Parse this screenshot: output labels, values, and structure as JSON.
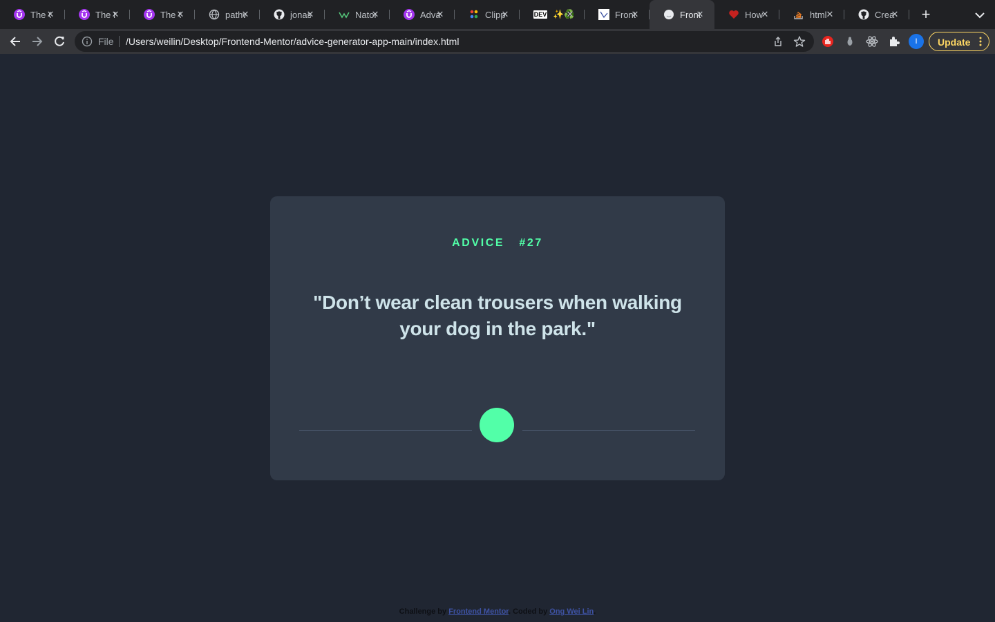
{
  "browser": {
    "tabs": [
      {
        "title": "The C",
        "icon": "udemy-icon"
      },
      {
        "title": "The N",
        "icon": "udemy-icon"
      },
      {
        "title": "The C",
        "icon": "udemy-icon"
      },
      {
        "title": "pathw",
        "icon": "globe-icon"
      },
      {
        "title": "jonas",
        "icon": "github-icon"
      },
      {
        "title": "Nator",
        "icon": "natours-icon"
      },
      {
        "title": "Adva",
        "icon": "udemy-icon"
      },
      {
        "title": "Clipp",
        "icon": "dots-icon"
      },
      {
        "title": "✨♻️",
        "icon": "dev-icon",
        "badge": "DEV"
      },
      {
        "title": "Front",
        "icon": "frontendmentor-icon"
      },
      {
        "title": "Front",
        "icon": "blank-page-icon",
        "active": true
      },
      {
        "title": "How",
        "icon": "heart-icon"
      },
      {
        "title": "html",
        "icon": "stackoverflow-icon"
      },
      {
        "title": "Crea",
        "icon": "github-icon"
      }
    ],
    "address": {
      "scheme": "File",
      "url": "/Users/weilin/Desktop/Frontend-Mentor/advice-generator-app-main/index.html"
    },
    "profile_initial": "I",
    "update_label": "Update"
  },
  "card": {
    "label": "ADVICE",
    "number": "#27",
    "quote": "\"Don’t wear clean trousers when walking your dog in the park.\""
  },
  "footer": {
    "prefix": "Challenge by",
    "link1": "Frontend Mentor",
    "middle": ". Coded by",
    "link2": "Ong Wei Lin",
    "suffix": "."
  },
  "colors": {
    "page_bg": "#202632",
    "card_bg": "#313a48",
    "accent": "#52ffa8",
    "quote_text": "#cee3e9",
    "divider": "#4f5d74"
  }
}
